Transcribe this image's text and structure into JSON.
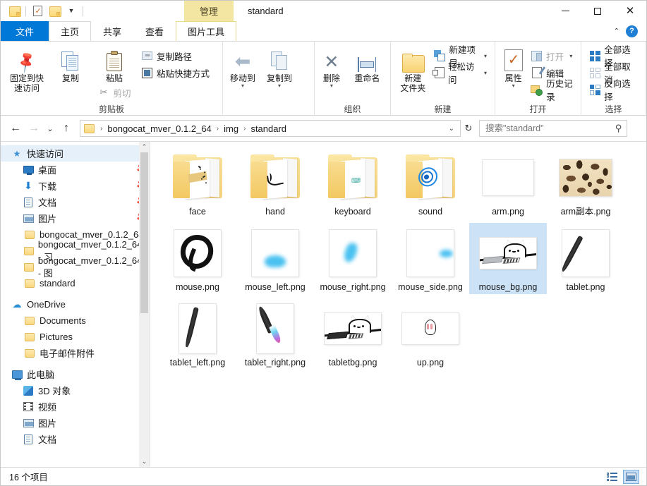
{
  "window": {
    "title": "standard",
    "contextual_tab": "管理",
    "minimize": "—",
    "maximize": "□",
    "close": "✕"
  },
  "quick_access_toolbar": {
    "items": [
      {
        "name": "properties-folder",
        "icon": "folder-icon"
      },
      {
        "name": "properties",
        "icon": "properties-icon"
      },
      {
        "name": "new-folder",
        "icon": "new-folder-icon"
      },
      {
        "name": "customize",
        "icon": "chevron-down-icon"
      }
    ]
  },
  "tabs": [
    {
      "id": "file",
      "label": "文件",
      "active": false,
      "style": "file"
    },
    {
      "id": "home",
      "label": "主页",
      "active": true,
      "style": "main"
    },
    {
      "id": "share",
      "label": "共享",
      "active": false,
      "style": "main"
    },
    {
      "id": "view",
      "label": "查看",
      "active": false,
      "style": "main"
    },
    {
      "id": "picture-tools",
      "label": "图片工具",
      "active": false,
      "style": "contextual"
    }
  ],
  "ribbon": {
    "collapse_icon": "⌃",
    "help_icon": "?",
    "groups": [
      {
        "id": "clipboard",
        "label": "剪贴板",
        "large": [
          {
            "name": "pin-to-quick-access",
            "label": "固定到快\n速访问",
            "line1": "固定到快",
            "line2": "速访问",
            "icon": "pin-icon"
          },
          {
            "name": "copy",
            "label": "复制",
            "icon": "copy-icon"
          },
          {
            "name": "paste",
            "label": "粘贴",
            "icon": "clipboard-icon"
          }
        ],
        "small": [
          {
            "name": "copy-path",
            "label": "复制路径",
            "icon": "copy-path-icon",
            "dim": false
          },
          {
            "name": "paste-shortcut",
            "label": "粘贴快捷方式",
            "icon": "paste-shortcut-icon",
            "dim": false
          },
          {
            "name": "cut",
            "label": "剪切",
            "icon": "scissors-icon",
            "dim": true
          }
        ]
      },
      {
        "id": "organize",
        "label": "组织",
        "large": [
          {
            "name": "move-to",
            "label": "移动到",
            "icon": "move-to-icon",
            "dropdown": true
          },
          {
            "name": "copy-to",
            "label": "复制到",
            "icon": "copy-to-icon",
            "dropdown": true
          },
          {
            "name": "delete",
            "label": "删除",
            "icon": "delete-icon",
            "dropdown": true
          },
          {
            "name": "rename",
            "label": "重命名",
            "icon": "rename-icon",
            "dropdown": false
          }
        ]
      },
      {
        "id": "new",
        "label": "新建",
        "large": [
          {
            "name": "new-folder",
            "line1": "新建",
            "line2": "文件夹",
            "label": "新建文件夹",
            "icon": "new-folder-icon"
          }
        ],
        "small": [
          {
            "name": "new-item",
            "label": "新建项目",
            "icon": "new-item-icon",
            "dropdown": true
          },
          {
            "name": "easy-access",
            "label": "轻松访问",
            "icon": "easy-access-icon",
            "dropdown": true
          }
        ]
      },
      {
        "id": "open",
        "label": "打开",
        "large": [
          {
            "name": "properties",
            "label": "属性",
            "icon": "properties-icon",
            "dropdown": true
          }
        ],
        "small": [
          {
            "name": "open",
            "label": "打开",
            "icon": "open-icon",
            "dropdown": true,
            "dim": true
          },
          {
            "name": "edit",
            "label": "编辑",
            "icon": "edit-icon",
            "dim": false
          },
          {
            "name": "history",
            "label": "历史记录",
            "icon": "history-icon",
            "dim": false
          }
        ]
      },
      {
        "id": "select",
        "label": "选择",
        "small": [
          {
            "name": "select-all",
            "label": "全部选择",
            "icon": "select-all-icon"
          },
          {
            "name": "select-none",
            "label": "全部取消",
            "icon": "select-none-icon"
          },
          {
            "name": "invert-selection",
            "label": "反向选择",
            "icon": "invert-selection-icon"
          }
        ]
      }
    ]
  },
  "navigation": {
    "back": "←",
    "forward": "→",
    "recent": "⌄",
    "up": "↑",
    "breadcrumb": [
      "bongocat_mver_0.1.2_64",
      "img",
      "standard"
    ],
    "breadcrumb_separator": "›",
    "dropdown": "⌄",
    "refresh": "↻"
  },
  "search": {
    "placeholder": "搜索\"standard\"",
    "value": "",
    "icon": "search-icon"
  },
  "sidebar": {
    "items": [
      {
        "label": "快速访问",
        "icon": "star-icon",
        "indent": 1,
        "selected": true,
        "pin": false
      },
      {
        "label": "桌面",
        "icon": "desktop-icon",
        "indent": 2,
        "selected": false,
        "pin": true
      },
      {
        "label": "下载",
        "icon": "download-icon",
        "indent": 2,
        "selected": false,
        "pin": true
      },
      {
        "label": "文档",
        "icon": "documents-icon",
        "indent": 2,
        "selected": false,
        "pin": true
      },
      {
        "label": "图片",
        "icon": "pictures-icon",
        "indent": 2,
        "selected": false,
        "pin": true
      },
      {
        "label": "bongocat_mver_0.1.2_64",
        "icon": "folder-icon",
        "indent": 2,
        "selected": false,
        "pin": false
      },
      {
        "label": "bongocat_mver_0.1.2_64 - 习",
        "icon": "folder-icon",
        "indent": 2,
        "selected": false,
        "pin": false
      },
      {
        "label": "bongocat_mver_0.1.2_64 - 图",
        "icon": "folder-icon",
        "indent": 2,
        "selected": false,
        "pin": false
      },
      {
        "label": "standard",
        "icon": "folder-icon",
        "indent": 2,
        "selected": false,
        "pin": false
      },
      {
        "label": "OneDrive",
        "icon": "cloud-icon",
        "indent": 1,
        "selected": false,
        "pin": false
      },
      {
        "label": "Documents",
        "icon": "folder-icon",
        "indent": 2,
        "selected": false,
        "pin": false
      },
      {
        "label": "Pictures",
        "icon": "folder-icon",
        "indent": 2,
        "selected": false,
        "pin": false
      },
      {
        "label": "电子邮件附件",
        "icon": "folder-icon",
        "indent": 2,
        "selected": false,
        "pin": false
      },
      {
        "label": "此电脑",
        "icon": "pc-icon",
        "indent": 1,
        "selected": false,
        "pin": false
      },
      {
        "label": "3D 对象",
        "icon": "3d-object-icon",
        "indent": 2,
        "selected": false,
        "pin": false
      },
      {
        "label": "视频",
        "icon": "videos-icon",
        "indent": 2,
        "selected": false,
        "pin": false
      },
      {
        "label": "图片",
        "icon": "pictures-icon",
        "indent": 2,
        "selected": false,
        "pin": false
      },
      {
        "label": "文档",
        "icon": "documents-icon",
        "indent": 2,
        "selected": false,
        "pin": false
      }
    ],
    "scroll_up": "⌃",
    "scroll_down": "⌄"
  },
  "files": [
    {
      "name": "face",
      "kind": "folder",
      "art": "face",
      "selected": false
    },
    {
      "name": "hand",
      "kind": "folder",
      "art": "hand",
      "selected": false
    },
    {
      "name": "keyboard",
      "kind": "folder",
      "art": "keyboard",
      "selected": false
    },
    {
      "name": "sound",
      "kind": "folder",
      "art": "sound",
      "selected": false
    },
    {
      "name": "arm.png",
      "kind": "image",
      "art": "blank-wide",
      "selected": false
    },
    {
      "name": "arm副本.png",
      "kind": "image",
      "art": "leopard",
      "selected": false
    },
    {
      "name": "mouse.png",
      "kind": "image",
      "art": "mouse-ring",
      "selected": false
    },
    {
      "name": "mouse_left.png",
      "kind": "image",
      "art": "blob-left",
      "selected": false
    },
    {
      "name": "mouse_right.png",
      "kind": "image",
      "art": "blob-right",
      "selected": false
    },
    {
      "name": "mouse_side.png",
      "kind": "image",
      "art": "blob-side",
      "selected": false
    },
    {
      "name": "mouse_bg.png",
      "kind": "image",
      "art": "cat-mouse",
      "selected": true
    },
    {
      "name": "tablet.png",
      "kind": "image",
      "art": "pen",
      "selected": false
    },
    {
      "name": "tablet_left.png",
      "kind": "image",
      "art": "pen-left",
      "selected": false
    },
    {
      "name": "tablet_right.png",
      "kind": "image",
      "art": "pen-right",
      "selected": false
    },
    {
      "name": "tabletbg.png",
      "kind": "image",
      "art": "cat-tablet",
      "selected": false
    },
    {
      "name": "up.png",
      "kind": "image",
      "art": "up-hand",
      "selected": false
    }
  ],
  "status": {
    "item_count": "16 个项目",
    "views": [
      {
        "name": "details-view",
        "icon": "details-view-icon",
        "active": false
      },
      {
        "name": "large-icons-view",
        "icon": "large-icons-view-icon",
        "active": true
      }
    ]
  }
}
